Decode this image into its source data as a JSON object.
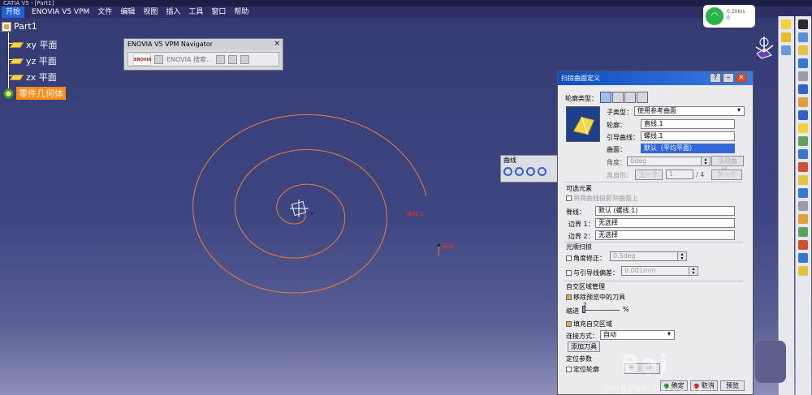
{
  "window": {
    "title": "CATIA V5 - [Part1]"
  },
  "menu": {
    "start": "开始",
    "items": [
      "ENOVIA V5 VPM",
      "文件",
      "编辑",
      "视图",
      "插入",
      "工具",
      "窗口",
      "帮助"
    ]
  },
  "tree": {
    "root": "Part1",
    "planes": [
      "xy 平面",
      "yz 平面",
      "zx 平面"
    ],
    "body": "零件几何体"
  },
  "navigator": {
    "title": "ENOVIA V5 VPM Navigator",
    "logo": "ENOVIA",
    "search_label": "ENOVIA 搜索..."
  },
  "curve_toolbar": {
    "title": "曲线"
  },
  "network": {
    "speed": "0.20K/s",
    "count": "0"
  },
  "geometry": {
    "spiral_label": "螺线.1",
    "line_label": "直线"
  },
  "dialog": {
    "title": "扫掠曲面定义",
    "profile_type_label": "轮廓类型：",
    "subtype_label": "子类型：",
    "subtype_value": "使用参考曲面",
    "profile_label": "轮廓：",
    "profile_value": "直线.1",
    "guide_label": "引导曲线：",
    "guide_value": "螺线.1",
    "surface_label": "曲面：",
    "surface_value": "默认（平均平面）",
    "angle_label": "角度：",
    "angle_value": "0deg",
    "law_btn": "法则曲线...",
    "angle_sector_label": "角扇形：",
    "prev_btn": "上一个",
    "sector_index": "1",
    "sector_total": "/ 4",
    "next_btn": "下一个",
    "optional_title": "可选元素",
    "projection_check": "将两曲线投影到曲面上",
    "spine_label": "脊线：",
    "spine_value": "默认 (螺线.1)",
    "boundary1_label": "边界 1：",
    "boundary1_value": "无选择",
    "boundary2_label": "边界 2：",
    "boundary2_value": "无选择",
    "smooth_title": "光顺扫掠",
    "angle_correction_label": "角度修正：",
    "angle_correction_value": "0.5deg",
    "deviation_label": "与引导线偏差：",
    "deviation_value": "0.001mm",
    "self_title": "自交区域管理",
    "remove_tools": "移除预览中的刀具",
    "taper_label": "缩进",
    "taper_value": "2",
    "taper_unit": "%",
    "fill_self": "填充自交区域",
    "connect_label": "连接方式：",
    "connect_value": "自动",
    "add_tool_btn": "添加刀具",
    "position_title": "定位参数",
    "position_profile": "定位轮廓",
    "show_params_btn": "显示参数",
    "ok_btn": "确定",
    "cancel_btn": "取消",
    "preview_btn": "预览"
  },
  "watermark": {
    "main": "Bai",
    "sub": "jingyan.baidu.com"
  }
}
